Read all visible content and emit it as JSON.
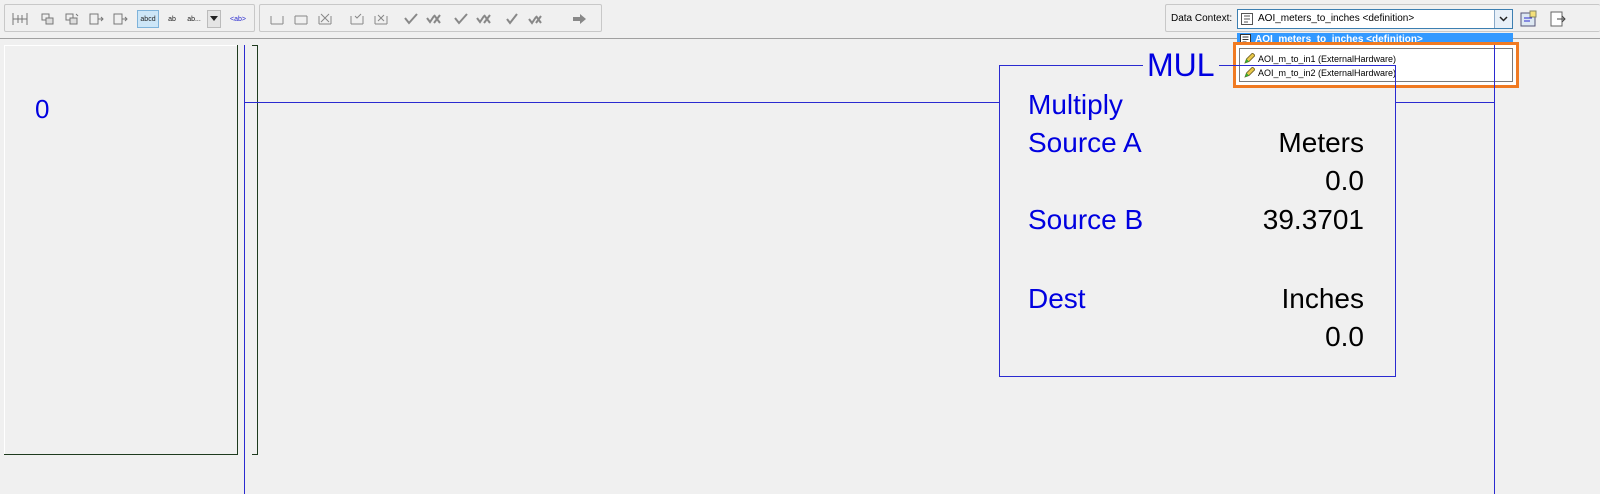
{
  "toolbar": {
    "buttons": [
      {
        "icon": "rung-insert-icon"
      },
      {
        "icon": "rung-branch-icon"
      },
      {
        "icon": "rung-branch-level-icon"
      },
      {
        "icon": "element-insert-icon"
      },
      {
        "icon": "element-edit-icon"
      },
      {
        "icon": "abcd-display-icon",
        "label": "abcd"
      },
      {
        "icon": "ab-toggle-icon",
        "label": "ab"
      },
      {
        "icon": "ab-more-icon",
        "label": "ab..."
      },
      {
        "icon": "dropdown-arrow-icon"
      },
      {
        "icon": "ab-tag-icon",
        "label": "<ab>"
      }
    ],
    "edit_buttons": [
      "start-rung-edits-icon",
      "accept-rung-edits-icon",
      "cancel-rung-edits-icon",
      "finalize-rung-icon",
      "cancel-program-edits-icon",
      "accept-pending-icon",
      "cancel-pending-icon",
      "test-edits-icon",
      "untest-edits-icon",
      "assemble-edits-icon",
      "cancel-assemble-icon",
      "forward-arrow-icon"
    ]
  },
  "data_context": {
    "label": "Data Context:",
    "selected": "AOI_meters_to_inches <definition>",
    "list_selected": "AOI_meters_to_inches <definition>",
    "instances": [
      {
        "icon": "pencil-icon",
        "label": "AOI_m_to_in1 (ExternalHardware)"
      },
      {
        "icon": "pencil-icon",
        "label": "AOI_m_to_in2 (ExternalHardware)"
      }
    ],
    "highlight_color": "#f07a22",
    "selection_color": "#3399ff"
  },
  "ladder": {
    "rung_number": "0",
    "rung_color": "#0000e0",
    "instruction": {
      "mnemonic": "MUL",
      "description": "Multiply",
      "source_a_label": "Source A",
      "source_a_tag": "Meters",
      "source_a_value": "0.0",
      "source_b_label": "Source B",
      "source_b_value": "39.3701",
      "dest_label": "Dest",
      "dest_tag": "Inches",
      "dest_value": "0.0"
    }
  }
}
